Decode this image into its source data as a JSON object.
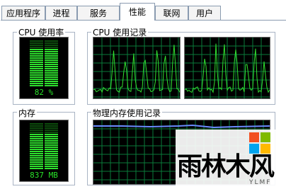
{
  "tabs": [
    {
      "label": "应用程序",
      "active": false
    },
    {
      "label": "进程",
      "active": false
    },
    {
      "label": "服务",
      "active": false
    },
    {
      "label": "性能",
      "active": true
    },
    {
      "label": "联网",
      "active": false
    },
    {
      "label": "用户",
      "active": false
    }
  ],
  "cpu_usage": {
    "label": "CPU 使用率",
    "value": "82 %",
    "level": 0.82
  },
  "cpu_history": {
    "label": "CPU 使用记录"
  },
  "memory": {
    "label": "内存",
    "value": "837 MB",
    "level": 0.8
  },
  "memory_history": {
    "label": "物理内存使用记录"
  },
  "watermark": {
    "text": "雨林木风",
    "sub": "YLMF"
  },
  "colors": {
    "meter_on": "#2ee02e",
    "meter_off": "#0d4d0d",
    "grid": "#0a7a3a",
    "trace": "#30e030",
    "memory_trace": "#6a8cff"
  }
}
